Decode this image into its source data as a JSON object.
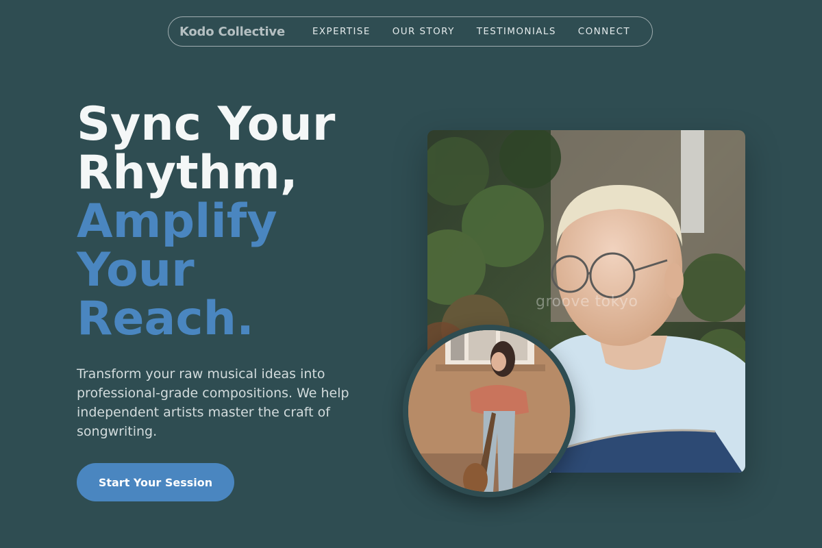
{
  "nav": {
    "brand": "Kodo Collective",
    "links": [
      "EXPERTISE",
      "OUR STORY",
      "TESTIMONIALS",
      "CONNECT"
    ]
  },
  "hero": {
    "title_line1": "Sync Your",
    "title_line2": "Rhythm,",
    "title_accent_line1": "Amplify",
    "title_accent_line2": "Your",
    "title_accent_line3": "Reach.",
    "description": "Transform your raw musical ideas into professional-grade compositions. We help independent artists master the craft of songwriting.",
    "cta_label": "Start Your Session"
  },
  "images": {
    "main_watermark": "groove tokyo",
    "main_alt": "Man with glasses holding a guitar",
    "circle_alt": "Woman leaning on a wall with a guitar"
  },
  "colors": {
    "background": "#2f4d52",
    "accent": "#4a86c0",
    "text": "#f4f7f7"
  }
}
